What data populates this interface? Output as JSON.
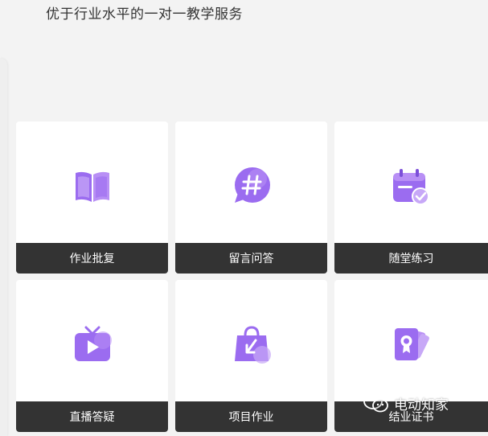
{
  "header": {
    "tagline": "优于行业水平的一对一教学服务"
  },
  "features": [
    {
      "label": "作业批复",
      "icon": "open-book-icon"
    },
    {
      "label": "留言问答",
      "icon": "hashtag-chat-icon"
    },
    {
      "label": "随堂练习",
      "icon": "calendar-check-icon"
    },
    {
      "label": "直播答疑",
      "icon": "tv-play-icon"
    },
    {
      "label": "项目作业",
      "icon": "shopping-bag-arrow-icon"
    },
    {
      "label": "结业证书",
      "icon": "certificate-cards-icon"
    }
  ],
  "watermark": {
    "text": "电动知家",
    "icon": "wechat-icon"
  },
  "colors": {
    "accent": "#9b6cf0",
    "accent_light": "#c7a8f7",
    "label_bar": "#333333",
    "card_bg": "#ffffff",
    "page_bg": "#f3f3f3"
  }
}
